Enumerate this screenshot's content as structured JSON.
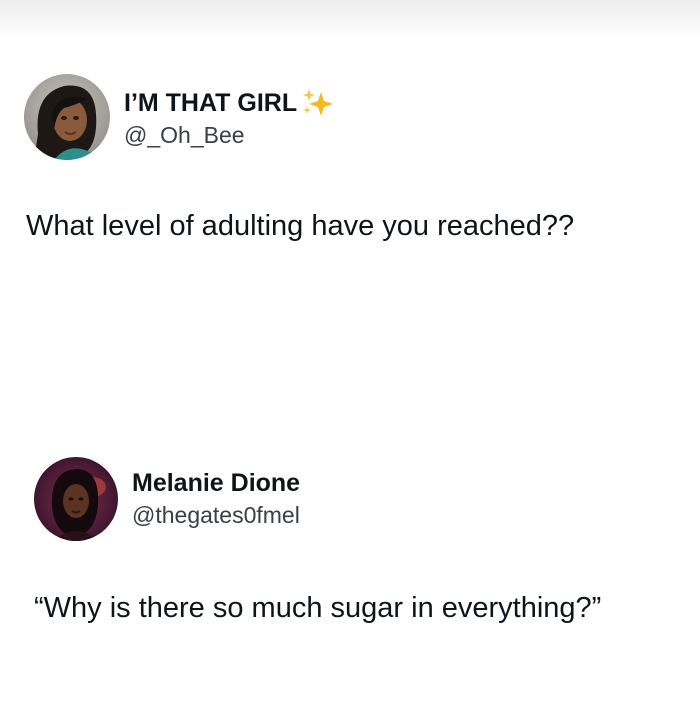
{
  "tweets": [
    {
      "display_name": "I’M THAT GIRL",
      "handle": "@_Oh_Bee",
      "name_emoji": "sparkles-icon",
      "text": "What level of adulting have you reached??"
    },
    {
      "display_name": "Melanie Dione",
      "handle": "@thegates0fmel",
      "text": "“Why is there so much sugar in everything?”"
    }
  ],
  "colors": {
    "text_primary": "#0f1419",
    "text_secondary": "#3a3f45",
    "sparkle": "#f5b91e",
    "background": "#ffffff"
  }
}
